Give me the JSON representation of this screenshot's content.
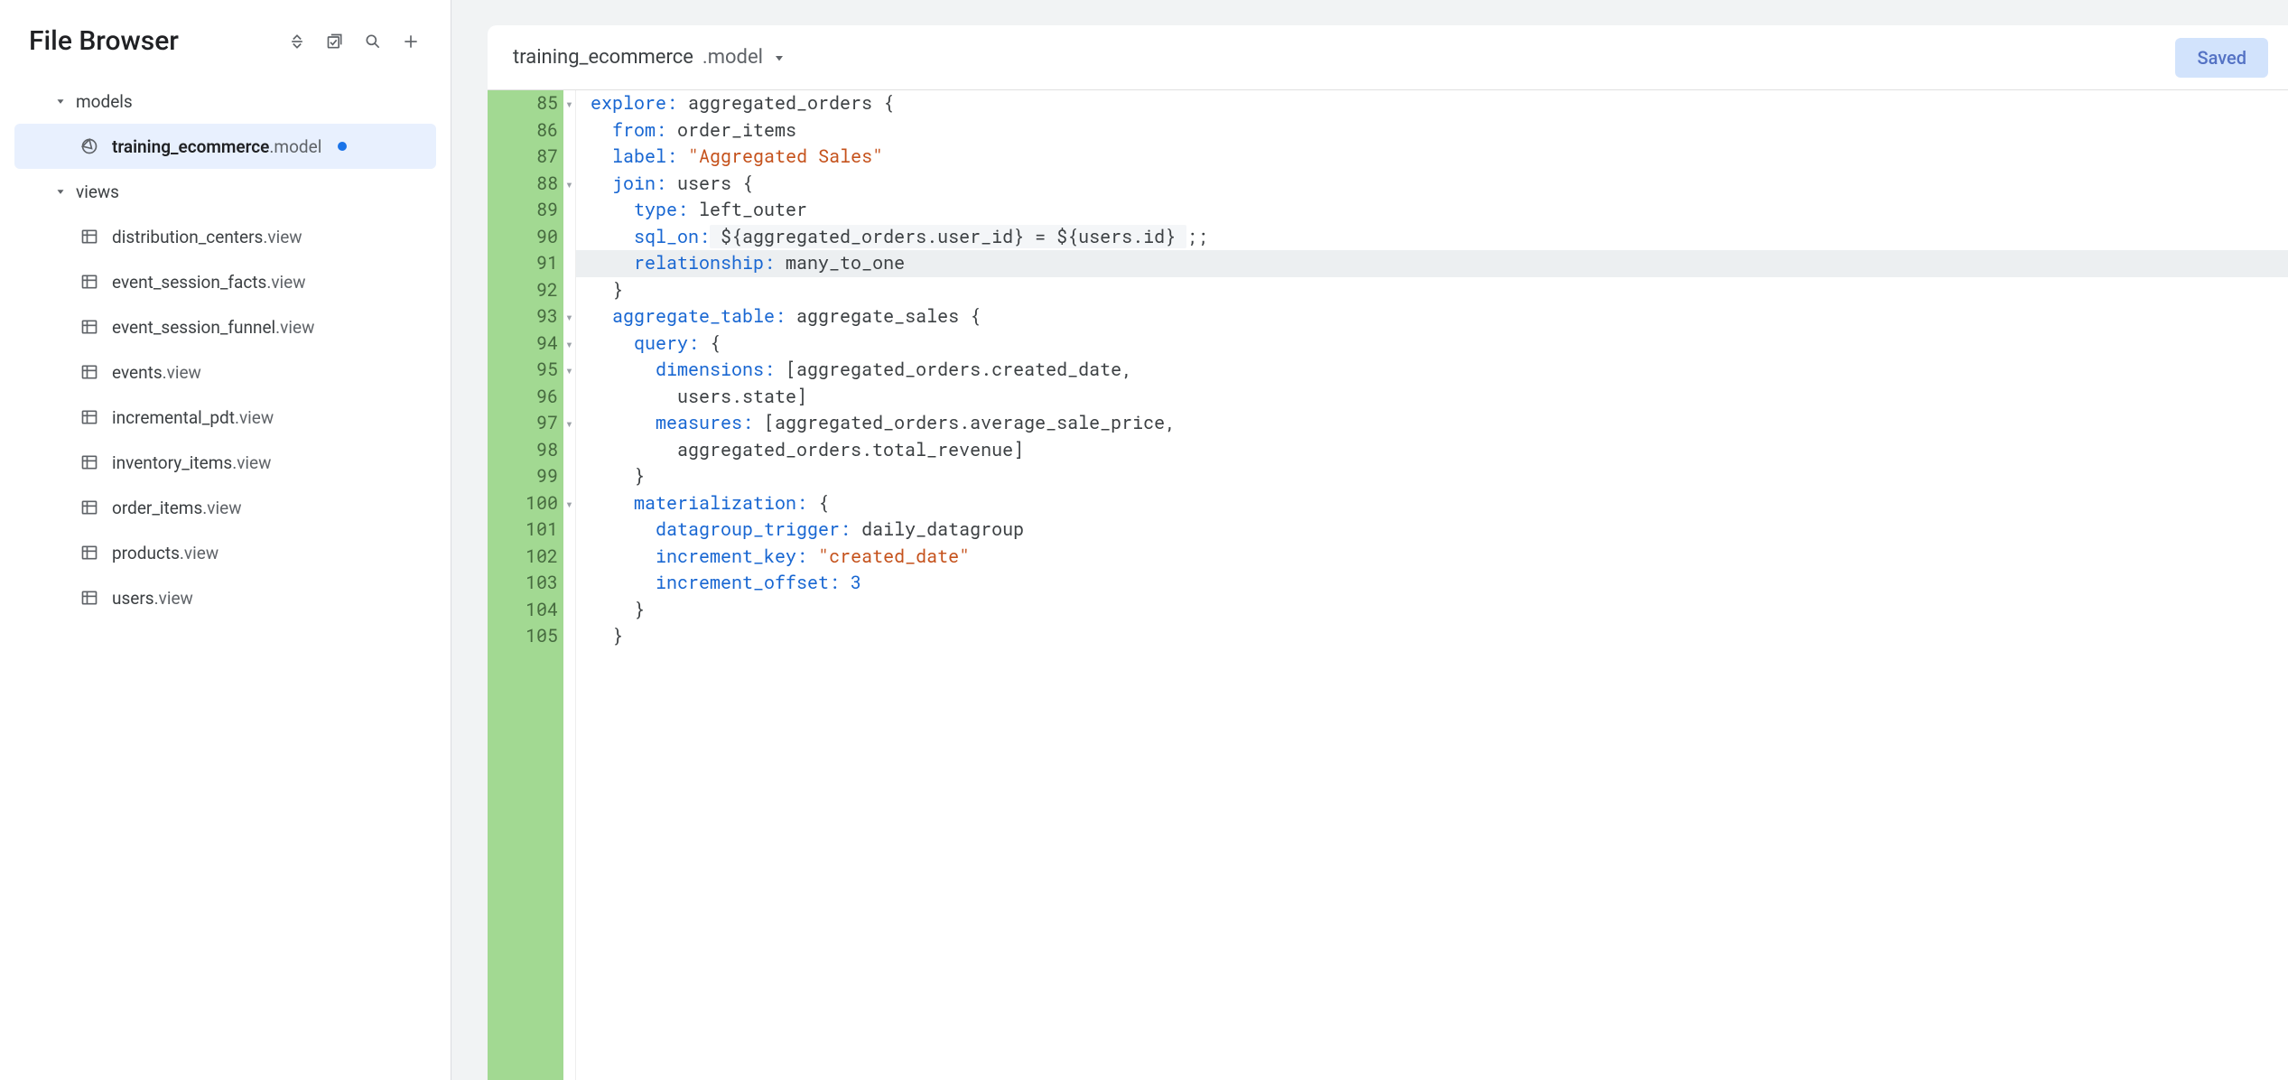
{
  "sidebar": {
    "title": "File Browser",
    "folders": [
      {
        "label": "models"
      },
      {
        "label": "views"
      }
    ],
    "model_file": {
      "name": "training_ecommerce",
      "ext": ".model"
    },
    "views": [
      {
        "name": "distribution_centers",
        "ext": ".view"
      },
      {
        "name": "event_session_facts",
        "ext": ".view"
      },
      {
        "name": "event_session_funnel",
        "ext": ".view"
      },
      {
        "name": "events",
        "ext": ".view"
      },
      {
        "name": "incremental_pdt",
        "ext": ".view"
      },
      {
        "name": "inventory_items",
        "ext": ".view"
      },
      {
        "name": "order_items",
        "ext": ".view"
      },
      {
        "name": "products",
        "ext": ".view"
      },
      {
        "name": "users",
        "ext": ".view"
      }
    ]
  },
  "editor": {
    "tab": {
      "name": "training_ecommerce",
      "ext": ".model"
    },
    "saved_label": "Saved",
    "lines": [
      {
        "n": "85",
        "fold": "▾",
        "tokens": [
          [
            "kw",
            "explore:"
          ],
          [
            "",
            " aggregated_orders "
          ],
          [
            "punc",
            "{"
          ]
        ]
      },
      {
        "n": "86",
        "fold": "",
        "tokens": [
          [
            "",
            "  "
          ],
          [
            "kw",
            "from:"
          ],
          [
            "",
            " order_items"
          ]
        ]
      },
      {
        "n": "87",
        "fold": "",
        "tokens": [
          [
            "",
            "  "
          ],
          [
            "kw",
            "label:"
          ],
          [
            "",
            " "
          ],
          [
            "str",
            "\"Aggregated Sales\""
          ]
        ]
      },
      {
        "n": "88",
        "fold": "▾",
        "tokens": [
          [
            "",
            "  "
          ],
          [
            "kw",
            "join:"
          ],
          [
            "",
            " users "
          ],
          [
            "punc",
            "{"
          ]
        ]
      },
      {
        "n": "89",
        "fold": "",
        "tokens": [
          [
            "",
            "    "
          ],
          [
            "kw",
            "type:"
          ],
          [
            "",
            " left_outer"
          ]
        ]
      },
      {
        "n": "90",
        "fold": "",
        "tokens": [
          [
            "",
            "    "
          ],
          [
            "kw",
            "sql_on:"
          ],
          [
            "intbg",
            " ${aggregated_orders.user_id} = ${users.id} "
          ],
          [
            "",
            ";;"
          ]
        ]
      },
      {
        "n": "91",
        "fold": "",
        "hl": true,
        "tokens": [
          [
            "",
            "    "
          ],
          [
            "kw",
            "relationship:"
          ],
          [
            "",
            " many_to_one"
          ]
        ]
      },
      {
        "n": "92",
        "fold": "",
        "tokens": [
          [
            "",
            "  "
          ],
          [
            "punc",
            "}"
          ]
        ]
      },
      {
        "n": "93",
        "fold": "▾",
        "tokens": [
          [
            "",
            "  "
          ],
          [
            "kw",
            "aggregate_table:"
          ],
          [
            "",
            " aggregate_sales "
          ],
          [
            "punc",
            "{"
          ]
        ]
      },
      {
        "n": "94",
        "fold": "▾",
        "tokens": [
          [
            "",
            "    "
          ],
          [
            "kw",
            "query:"
          ],
          [
            "",
            " "
          ],
          [
            "punc",
            "{"
          ]
        ]
      },
      {
        "n": "95",
        "fold": "▾",
        "tokens": [
          [
            "",
            "      "
          ],
          [
            "kw",
            "dimensions:"
          ],
          [
            "",
            " [aggregated_orders.created_date,"
          ]
        ]
      },
      {
        "n": "96",
        "fold": "",
        "tokens": [
          [
            "",
            "        users.state]"
          ]
        ]
      },
      {
        "n": "97",
        "fold": "▾",
        "tokens": [
          [
            "",
            "      "
          ],
          [
            "kw",
            "measures:"
          ],
          [
            "",
            " [aggregated_orders.average_sale_price,"
          ]
        ]
      },
      {
        "n": "98",
        "fold": "",
        "tokens": [
          [
            "",
            "        aggregated_orders.total_revenue]"
          ]
        ]
      },
      {
        "n": "99",
        "fold": "",
        "tokens": [
          [
            "",
            "    "
          ],
          [
            "punc",
            "}"
          ]
        ]
      },
      {
        "n": "100",
        "fold": "▾",
        "tokens": [
          [
            "",
            "    "
          ],
          [
            "kw",
            "materialization:"
          ],
          [
            "",
            " "
          ],
          [
            "punc",
            "{"
          ]
        ]
      },
      {
        "n": "101",
        "fold": "",
        "tokens": [
          [
            "",
            "      "
          ],
          [
            "kw",
            "datagroup_trigger:"
          ],
          [
            "",
            " daily_datagroup"
          ]
        ]
      },
      {
        "n": "102",
        "fold": "",
        "tokens": [
          [
            "",
            "      "
          ],
          [
            "kw",
            "increment_key:"
          ],
          [
            "",
            " "
          ],
          [
            "str",
            "\"created_date\""
          ]
        ]
      },
      {
        "n": "103",
        "fold": "",
        "tokens": [
          [
            "",
            "      "
          ],
          [
            "kw",
            "increment_offset:"
          ],
          [
            "",
            " "
          ],
          [
            "num",
            "3"
          ]
        ]
      },
      {
        "n": "104",
        "fold": "",
        "tokens": [
          [
            "",
            "    "
          ],
          [
            "punc",
            "}"
          ]
        ]
      },
      {
        "n": "105",
        "fold": "",
        "tokens": [
          [
            "",
            "  "
          ],
          [
            "punc",
            "}"
          ]
        ]
      }
    ]
  }
}
